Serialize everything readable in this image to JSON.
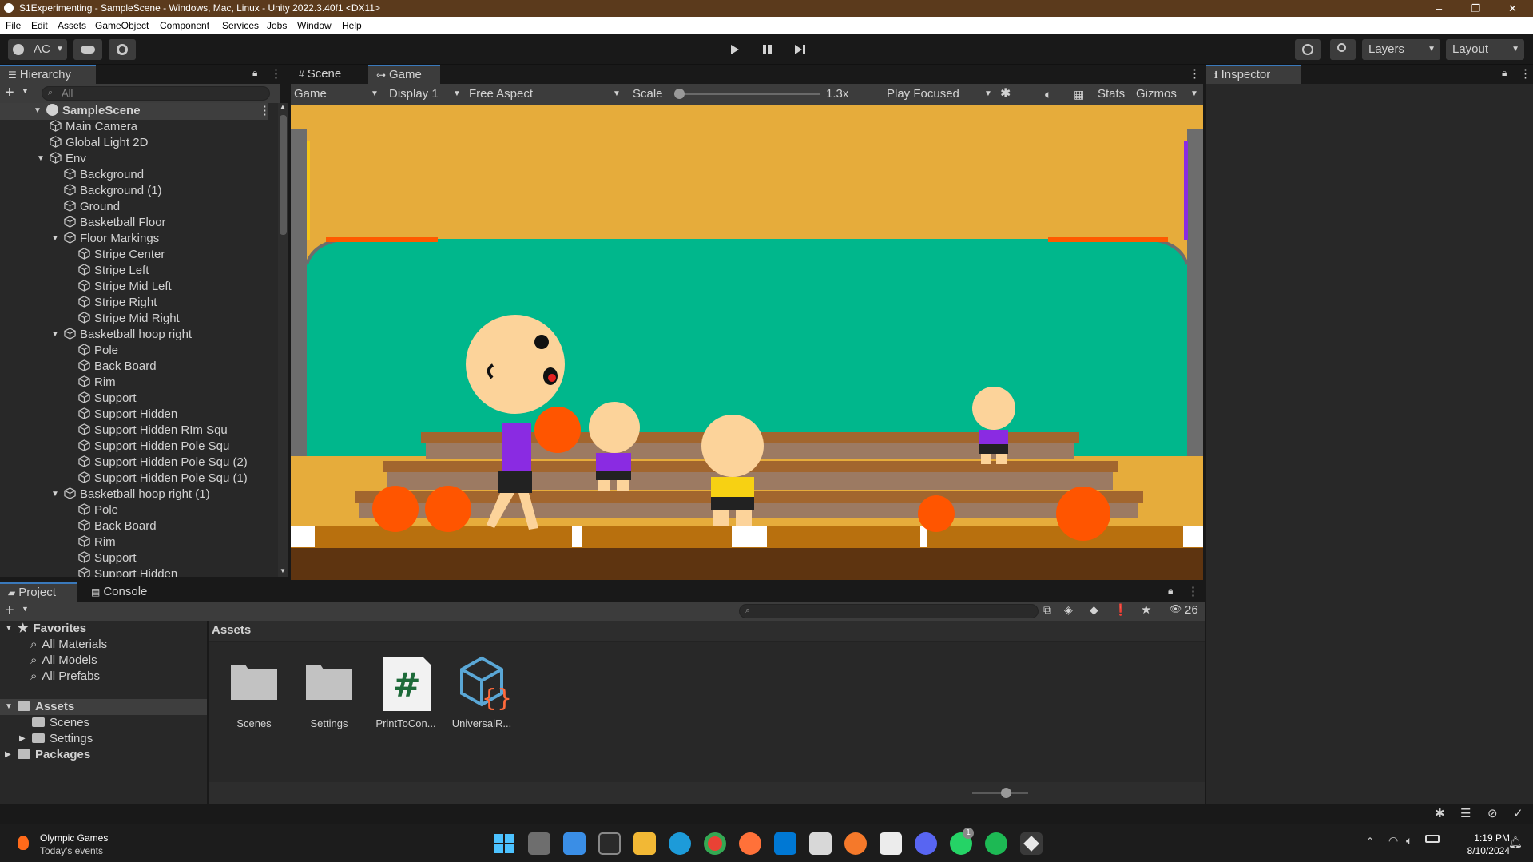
{
  "window": {
    "title": "S1Experimenting - SampleScene - Windows, Mac, Linux - Unity 2022.3.40f1 <DX11>",
    "minimize": "–",
    "maximize": "❐",
    "close": "✕"
  },
  "menu": [
    "File",
    "Edit",
    "Assets",
    "GameObject",
    "Component",
    "Services",
    "Jobs",
    "Window",
    "Help"
  ],
  "toolbar": {
    "account": "AC",
    "layers": "Layers",
    "layout": "Layout"
  },
  "hierarchy": {
    "tab": "Hierarchy",
    "search_placeholder": "All",
    "scene": "SampleScene",
    "items": [
      {
        "label": "Main Camera",
        "depth": 1
      },
      {
        "label": "Global Light 2D",
        "depth": 1
      },
      {
        "label": "Env",
        "depth": 1
      },
      {
        "label": "Background",
        "depth": 2
      },
      {
        "label": "Background (1)",
        "depth": 2
      },
      {
        "label": "Ground",
        "depth": 2
      },
      {
        "label": "Basketball Floor",
        "depth": 2
      },
      {
        "label": "Floor Markings",
        "depth": 2
      },
      {
        "label": "Stripe Center",
        "depth": 3
      },
      {
        "label": "Stripe Left",
        "depth": 3
      },
      {
        "label": "Stripe Mid Left",
        "depth": 3
      },
      {
        "label": "Stripe Right",
        "depth": 3
      },
      {
        "label": "Stripe Mid Right",
        "depth": 3
      },
      {
        "label": "Basketball hoop right",
        "depth": 2
      },
      {
        "label": "Pole",
        "depth": 3
      },
      {
        "label": "Back Board",
        "depth": 3
      },
      {
        "label": "Rim",
        "depth": 3
      },
      {
        "label": "Support",
        "depth": 3
      },
      {
        "label": "Support Hidden",
        "depth": 3
      },
      {
        "label": "Support Hidden RIm Squ",
        "depth": 3
      },
      {
        "label": "Support Hidden Pole Squ",
        "depth": 3
      },
      {
        "label": "Support Hidden Pole Squ (2)",
        "depth": 3
      },
      {
        "label": "Support Hidden Pole Squ (1)",
        "depth": 3
      },
      {
        "label": "Basketball hoop right (1)",
        "depth": 2
      },
      {
        "label": "Pole",
        "depth": 3
      },
      {
        "label": "Back Board",
        "depth": 3
      },
      {
        "label": "Rim",
        "depth": 3
      },
      {
        "label": "Support",
        "depth": 3
      },
      {
        "label": "Support Hidden",
        "depth": 3
      }
    ]
  },
  "views": {
    "scene_tab": "Scene",
    "game_tab": "Game",
    "game_dropdown": "Game",
    "display": "Display 1",
    "aspect": "Free Aspect",
    "scale_label": "Scale",
    "scale_value": "1.3x",
    "scale_fraction": 0.0,
    "play_mode": "Play Focused",
    "stats": "Stats",
    "gizmos": "Gizmos"
  },
  "inspector": {
    "tab": "Inspector"
  },
  "project": {
    "project_tab": "Project",
    "console_tab": "Console",
    "count": "26",
    "favorites": "Favorites",
    "fav_items": [
      "All Materials",
      "All Models",
      "All Prefabs"
    ],
    "assets_root": "Assets",
    "asset_children": [
      "Scenes",
      "Settings"
    ],
    "packages": "Packages",
    "breadcrumb": "Assets",
    "files": [
      {
        "label": "Scenes",
        "icon": "folder-icon"
      },
      {
        "label": "Settings",
        "icon": "folder-icon"
      },
      {
        "label": "PrintToCon...",
        "icon": "csharp-script-icon"
      },
      {
        "label": "UniversalR...",
        "icon": "render-pipeline-asset-icon"
      }
    ]
  },
  "taskbar": {
    "news_title": "Olympic Games",
    "news_sub": "Today's events",
    "time": "1:19 PM",
    "date": "8/10/2024",
    "whatsapp_badge": "1"
  }
}
